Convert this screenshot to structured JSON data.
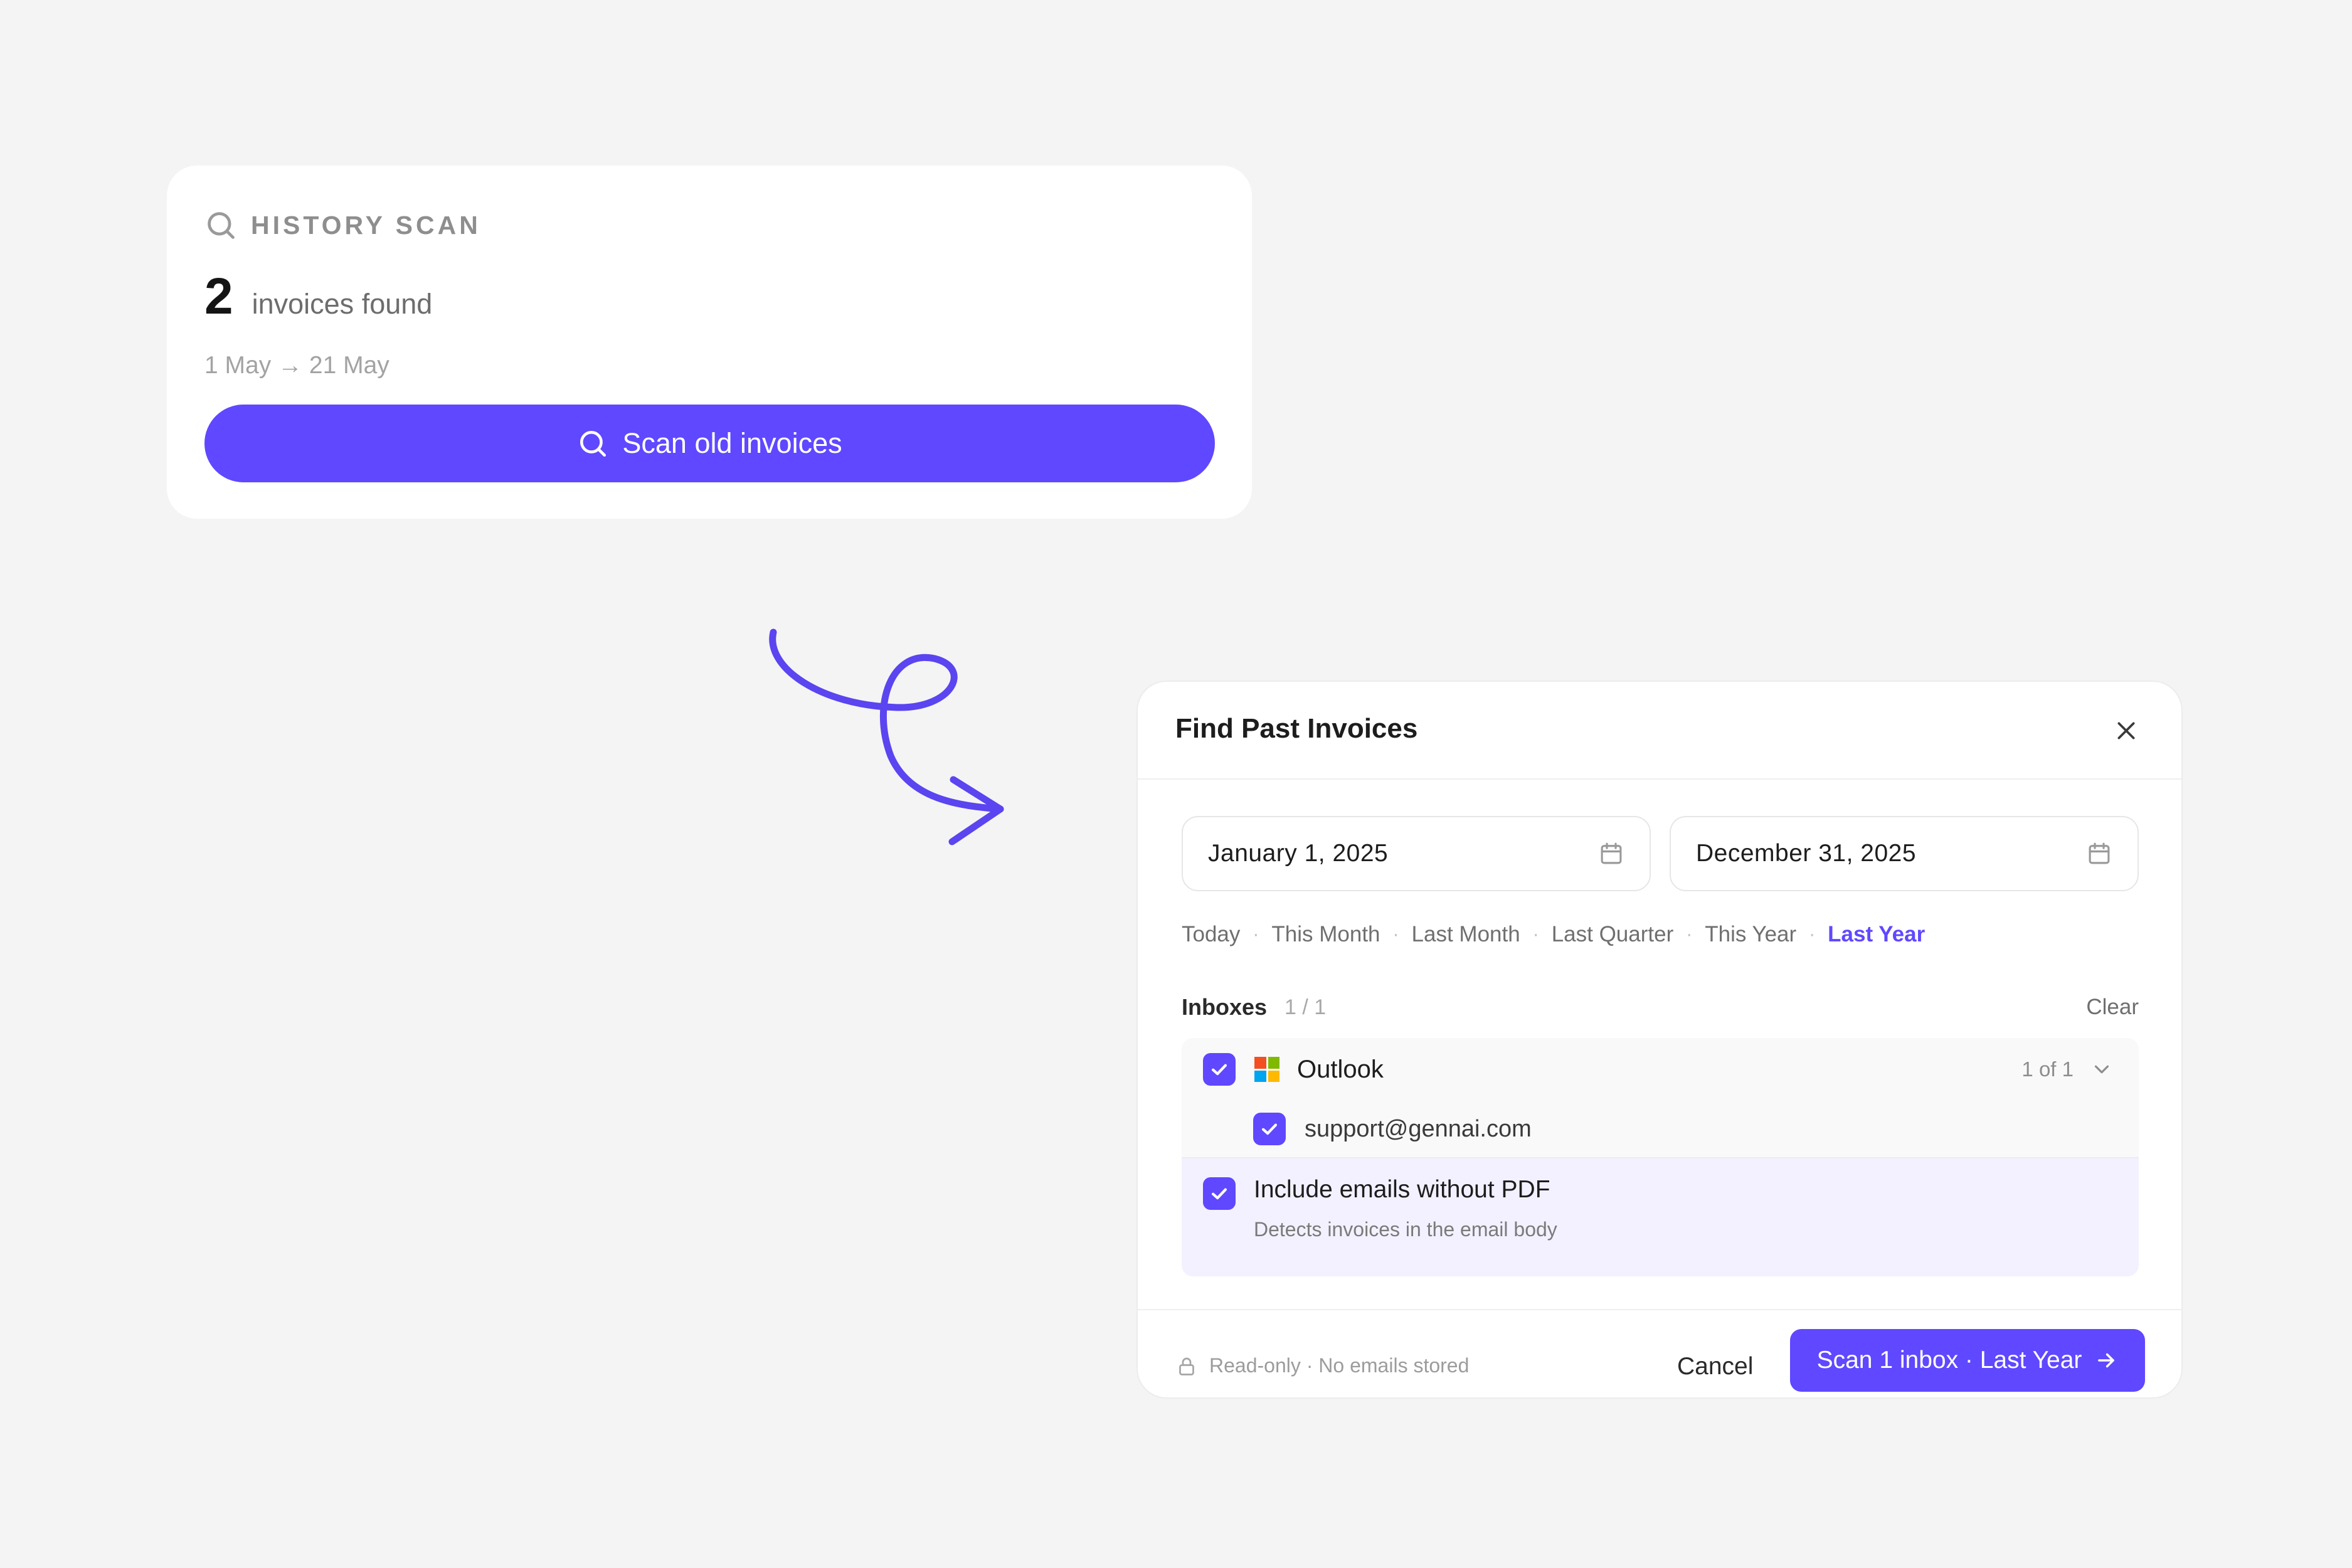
{
  "history_scan": {
    "title": "HISTORY SCAN",
    "count": "2",
    "count_label": "invoices found",
    "date_range": "1 May → 21 May",
    "button_label": "Scan old invoices"
  },
  "modal": {
    "title": "Find Past Invoices",
    "start_date": "January 1, 2025",
    "end_date": "December 31, 2025",
    "presets": [
      "Today",
      "This Month",
      "Last Month",
      "Last Quarter",
      "This Year",
      "Last Year"
    ],
    "active_preset": "Last Year",
    "inboxes": {
      "label": "Inboxes",
      "count": "1 / 1",
      "clear_label": "Clear",
      "provider": {
        "name": "Outlook",
        "selected_count": "1 of 1",
        "checked": true,
        "accounts": [
          {
            "email": "support@gennai.com",
            "checked": true
          }
        ]
      }
    },
    "include_no_pdf": {
      "title": "Include emails without PDF",
      "description": "Detects invoices in the email body",
      "checked": true
    },
    "footer": {
      "note": "Read-only · No emails stored",
      "cancel_label": "Cancel",
      "scan_label": "Scan 1 inbox · Last Year"
    }
  },
  "colors": {
    "accent": "#5f48ff",
    "background": "#f4f4f4",
    "ms_red": "#f25022",
    "ms_green": "#7fba00",
    "ms_blue": "#00a4ef",
    "ms_yellow": "#ffb900"
  },
  "icons": {
    "search": "search-icon",
    "close": "close-icon",
    "calendar": "calendar-icon",
    "check": "check-icon",
    "chevron": "chevron-down-icon",
    "lock": "lock-icon",
    "arrow": "arrow-right-icon",
    "logo": "microsoft-logo-icon"
  }
}
